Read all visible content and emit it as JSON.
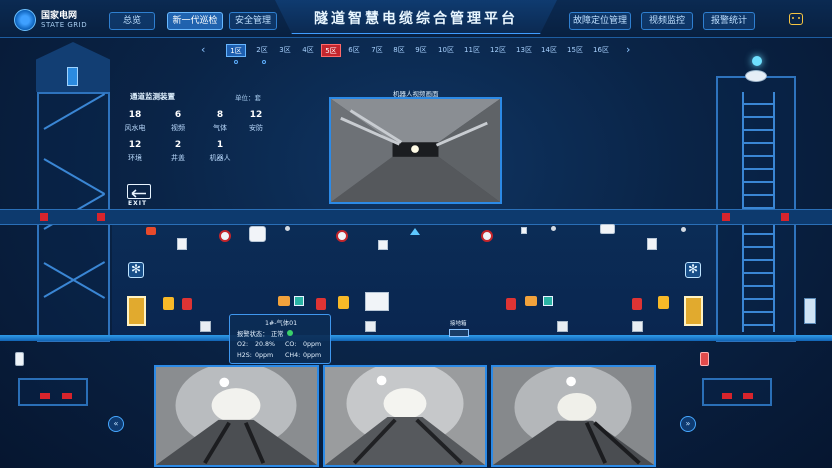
{
  "header": {
    "logo_cn": "国家电网",
    "logo_en": "STATE GRID",
    "title": "隧道智慧电缆综合管理平台",
    "nav_left": [
      "总览",
      "新一代巡检",
      "安全管理"
    ],
    "nav_right": [
      "故障定位管理",
      "视频监控",
      "报警统计"
    ],
    "active_nav": "新一代巡检"
  },
  "zones": {
    "items": [
      "1区",
      "2区",
      "3区",
      "4区",
      "5区",
      "6区",
      "7区",
      "8区",
      "9区",
      "10区",
      "11区",
      "12区",
      "13区",
      "14区",
      "15区",
      "16区"
    ],
    "selected": "1区",
    "alarm": "5区",
    "prev_arrow": "‹",
    "next_arrow": "›"
  },
  "monitor": {
    "title": "通道监测装置",
    "unit": "单位：套",
    "stats": [
      {
        "value": "18",
        "label": "风水电"
      },
      {
        "value": "6",
        "label": "视频"
      },
      {
        "value": "8",
        "label": "气体"
      },
      {
        "value": "12",
        "label": "安防"
      },
      {
        "value": "12",
        "label": "环境"
      },
      {
        "value": "2",
        "label": "井盖"
      },
      {
        "value": "1",
        "label": "机器人"
      }
    ]
  },
  "robot_video": {
    "title": "机器人视频画面"
  },
  "exit_sign": {
    "text": "EXIT"
  },
  "tooltip": {
    "name": "1#-气体01",
    "status_label": "报警状态：",
    "status_value": "正常",
    "o2_label": "O2:",
    "o2_value": "20.8%",
    "co_label": "CO:",
    "co_value": "0ppm",
    "h2s_label": "H2S:",
    "h2s_value": "0ppm",
    "ch4_label": "CH4:",
    "ch4_value": "0ppm",
    "status_color": "#3ad16a"
  },
  "device_label": {
    "text": "接地箱"
  },
  "nav_arrows": {
    "left": "«",
    "right": "»"
  },
  "colors": {
    "accent": "#2c8ae6",
    "alarm": "#c4262e",
    "background": "#071a33"
  }
}
